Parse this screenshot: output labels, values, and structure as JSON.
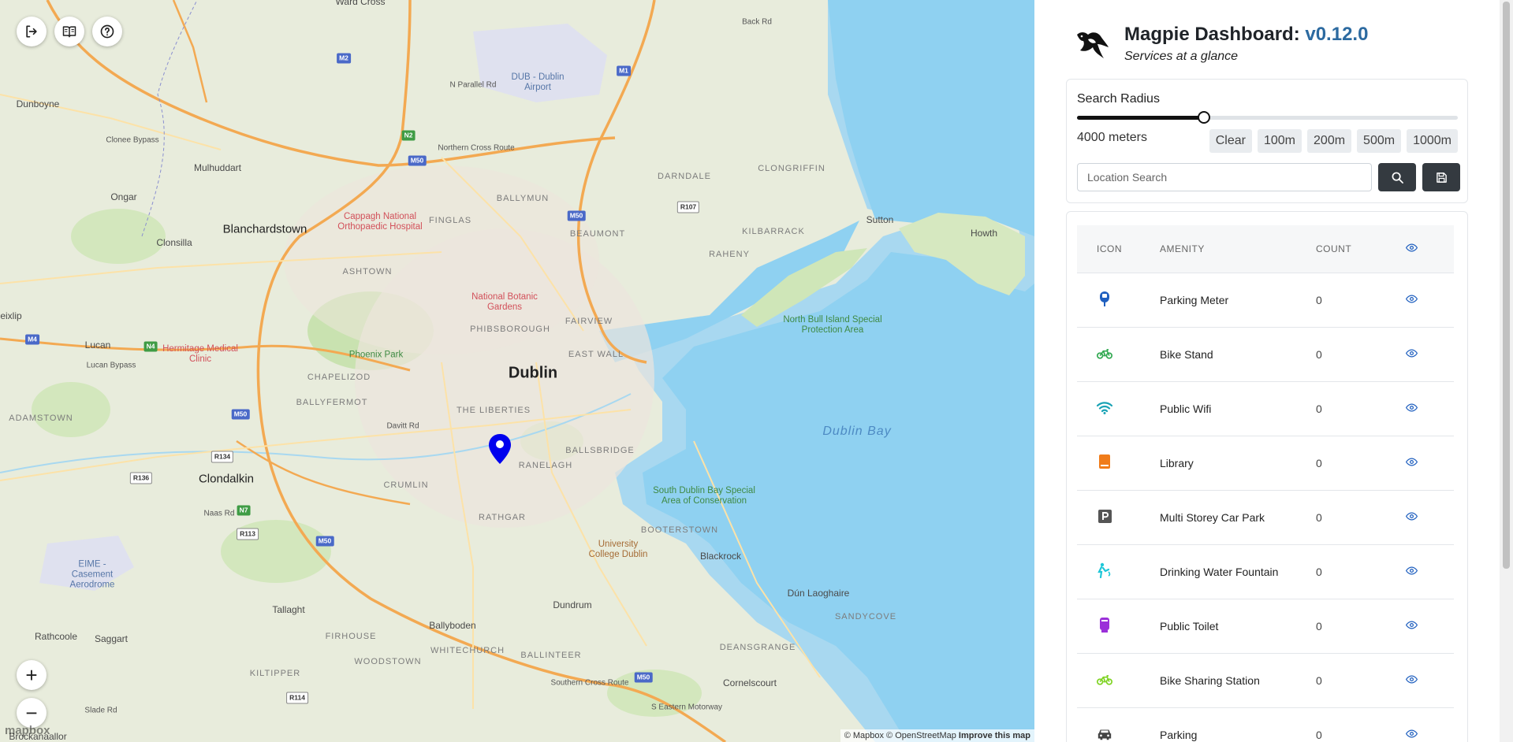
{
  "map": {
    "places": [
      {
        "text": "Ward Cross",
        "cls": "place"
      },
      {
        "text": "Back Rd",
        "cls": "place road"
      },
      {
        "text": "N Parallel Rd",
        "cls": "place road"
      },
      {
        "text": "DUB - Dublin Airport",
        "cls": "place poi-blue"
      },
      {
        "text": "Dunboyne",
        "cls": "place"
      },
      {
        "text": "Clonee Bypass",
        "cls": "place road"
      },
      {
        "text": "Mulhuddart",
        "cls": "place"
      },
      {
        "text": "Northern Cross Route",
        "cls": "place road"
      },
      {
        "text": "DARNDALE",
        "cls": "place suburb"
      },
      {
        "text": "CLONGRIFFIN",
        "cls": "place suburb"
      },
      {
        "text": "Ongar",
        "cls": "place"
      },
      {
        "text": "BALLYMUN",
        "cls": "place suburb"
      },
      {
        "text": "Cappagh National Orthopaedic Hospital",
        "cls": "place poi-red"
      },
      {
        "text": "FINGLAS",
        "cls": "place suburb"
      },
      {
        "text": "Blanchardstown",
        "cls": "place town"
      },
      {
        "text": "BEAUMONT",
        "cls": "place suburb"
      },
      {
        "text": "KILBARRACK",
        "cls": "place suburb"
      },
      {
        "text": "Sutton",
        "cls": "place"
      },
      {
        "text": "Howth",
        "cls": "place"
      },
      {
        "text": "Clonsilla",
        "cls": "place"
      },
      {
        "text": "RAHENY",
        "cls": "place suburb"
      },
      {
        "text": "ASHTOWN",
        "cls": "place suburb"
      },
      {
        "text": "National Botanic Gardens",
        "cls": "place poi-red"
      },
      {
        "text": "North Bull Island Special Protection Area",
        "cls": "place poi-green"
      },
      {
        "text": "eixlip",
        "cls": "place"
      },
      {
        "text": "FAIRVIEW",
        "cls": "place suburb"
      },
      {
        "text": "PHIBSBOROUGH",
        "cls": "place suburb"
      },
      {
        "text": "Lucan",
        "cls": "place"
      },
      {
        "text": "Hermitage Medical Clinic",
        "cls": "place poi-red"
      },
      {
        "text": "Lucan Bypass",
        "cls": "place road"
      },
      {
        "text": "Phoenix Park",
        "cls": "place poi-green"
      },
      {
        "text": "EAST WALL",
        "cls": "place suburb"
      },
      {
        "text": "Dublin",
        "cls": "place city"
      },
      {
        "text": "CHAPELIZOD",
        "cls": "place suburb"
      },
      {
        "text": "BALLYFERMOT",
        "cls": "place suburb"
      },
      {
        "text": "THE LIBERTIES",
        "cls": "place suburb"
      },
      {
        "text": "ADAMSTOWN",
        "cls": "place suburb"
      },
      {
        "text": "Davitt Rd",
        "cls": "place road"
      },
      {
        "text": "Dublin Bay",
        "cls": "place bay"
      },
      {
        "text": "BALLSBRIDGE",
        "cls": "place suburb"
      },
      {
        "text": "RANELAGH",
        "cls": "place suburb"
      },
      {
        "text": "Clondalkin",
        "cls": "place town"
      },
      {
        "text": "CRUMLIN",
        "cls": "place suburb"
      },
      {
        "text": "South Dublin Bay Special Area of Conservation",
        "cls": "place poi-green"
      },
      {
        "text": "Naas Rd",
        "cls": "place road"
      },
      {
        "text": "RATHGAR",
        "cls": "place suburb"
      },
      {
        "text": "BOOTERSTOWN",
        "cls": "place suburb"
      },
      {
        "text": "University College Dublin",
        "cls": "place poi-brown"
      },
      {
        "text": "EIME - Casement Aerodrome",
        "cls": "place poi-blue"
      },
      {
        "text": "Blackrock",
        "cls": "place"
      },
      {
        "text": "Dún Laoghaire",
        "cls": "place"
      },
      {
        "text": "Tallaght",
        "cls": "place"
      },
      {
        "text": "Dundrum",
        "cls": "place"
      },
      {
        "text": "SANDYCOVE",
        "cls": "place suburb"
      },
      {
        "text": "Rathcoole",
        "cls": "place"
      },
      {
        "text": "Saggart",
        "cls": "place"
      },
      {
        "text": "FIRHOUSE",
        "cls": "place suburb"
      },
      {
        "text": "Ballyboden",
        "cls": "place"
      },
      {
        "text": "WHITECHURCH",
        "cls": "place suburb"
      },
      {
        "text": "BALLINTEER",
        "cls": "place suburb"
      },
      {
        "text": "DEANSGRANGE",
        "cls": "place suburb"
      },
      {
        "text": "WOODSTOWN",
        "cls": "place suburb"
      },
      {
        "text": "Southern Cross Route",
        "cls": "place road"
      },
      {
        "text": "Cornelscourt",
        "cls": "place"
      },
      {
        "text": "KILTIPPER",
        "cls": "place suburb"
      },
      {
        "text": "S Eastern Motorway",
        "cls": "place road"
      },
      {
        "text": "Slade Rd",
        "cls": "place road"
      },
      {
        "text": "Brockanaallor",
        "cls": "place"
      }
    ],
    "shields": [
      {
        "text": "M2",
        "cls": "shield m"
      },
      {
        "text": "M1",
        "cls": "shield m"
      },
      {
        "text": "N2",
        "cls": "shield n"
      },
      {
        "text": "M50",
        "cls": "shield m"
      },
      {
        "text": "M50",
        "cls": "shield m"
      },
      {
        "text": "R107",
        "cls": "shield r"
      },
      {
        "text": "M4",
        "cls": "shield m"
      },
      {
        "text": "N4",
        "cls": "shield n"
      },
      {
        "text": "M50",
        "cls": "shield m"
      },
      {
        "text": "R134",
        "cls": "shield r"
      },
      {
        "text": "R136",
        "cls": "shield r"
      },
      {
        "text": "N7",
        "cls": "shield n"
      },
      {
        "text": "R113",
        "cls": "shield r"
      },
      {
        "text": "M50",
        "cls": "shield m"
      },
      {
        "text": "M50",
        "cls": "shield m"
      },
      {
        "text": "R114",
        "cls": "shield r"
      }
    ],
    "attribution": "© Mapbox © OpenStreetMap",
    "improve_link": "Improve this map",
    "mapbox_logo": "mapbox",
    "zoom_in": "+",
    "zoom_out": "−"
  },
  "header": {
    "title": "Magpie Dashboard: ",
    "version": "v0.12.0",
    "subtitle": "Services at a glance"
  },
  "radius": {
    "label": "Search Radius",
    "value_text": "4000 meters",
    "level": 0.333,
    "presets": [
      "Clear",
      "100m",
      "200m",
      "500m",
      "1000m"
    ]
  },
  "search": {
    "placeholder": "Location Search"
  },
  "table": {
    "headers": [
      "ICON",
      "AMENITY",
      "COUNT"
    ],
    "rows": [
      {
        "icon": "parking-meter-icon",
        "color": "#1f5fbf",
        "amenity": "Parking Meter",
        "count": "0"
      },
      {
        "icon": "bike-icon",
        "color": "#2fa84f",
        "amenity": "Bike Stand",
        "count": "0"
      },
      {
        "icon": "wifi-icon",
        "color": "#1aa3b5",
        "amenity": "Public Wifi",
        "count": "0"
      },
      {
        "icon": "book-icon",
        "color": "#f07c1a",
        "amenity": "Library",
        "count": "0"
      },
      {
        "icon": "parking-p-icon",
        "color": "#555555",
        "amenity": "Multi Storey Car Park",
        "count": "0"
      },
      {
        "icon": "water-fountain-icon",
        "color": "#1ec7d8",
        "amenity": "Drinking Water Fountain",
        "count": "0"
      },
      {
        "icon": "toilet-icon",
        "color": "#9b30d9",
        "amenity": "Public Toilet",
        "count": "0"
      },
      {
        "icon": "bike-share-icon",
        "color": "#7ed321",
        "amenity": "Bike Sharing Station",
        "count": "0"
      },
      {
        "icon": "car-icon",
        "color": "#444444",
        "amenity": "Parking",
        "count": "0"
      }
    ]
  }
}
